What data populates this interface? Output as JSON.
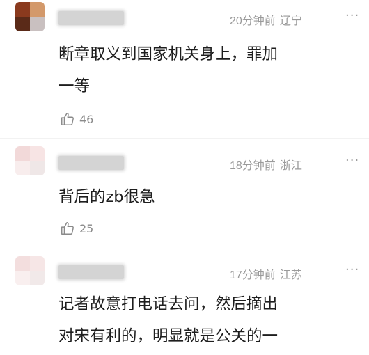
{
  "comments": [
    {
      "time": "20分钟前",
      "location": "辽宁",
      "more": "···",
      "lines": [
        "断章取义到国家机关身上，罪加",
        "一等"
      ],
      "likes": "46",
      "avatar_colors": [
        "#8a3a1e",
        "#d3996b",
        "#5a2a18",
        "#c9c0c0"
      ]
    },
    {
      "time": "18分钟前",
      "location": "浙江",
      "more": "···",
      "lines": [
        "背后的zb很急"
      ],
      "likes": "25",
      "avatar_colors": [
        "#f2d9d9",
        "#f7e4e4",
        "#f8eded",
        "#efe7e7"
      ]
    },
    {
      "time": "17分钟前",
      "location": "江苏",
      "more": "···",
      "lines": [
        "记者故意打电话去问，然后摘出",
        "对宋有利的，明显就是公关的一"
      ],
      "avatar_colors": [
        "#f3dede",
        "#f6e6e6",
        "#f9efef",
        "#f1e9e9"
      ]
    }
  ]
}
